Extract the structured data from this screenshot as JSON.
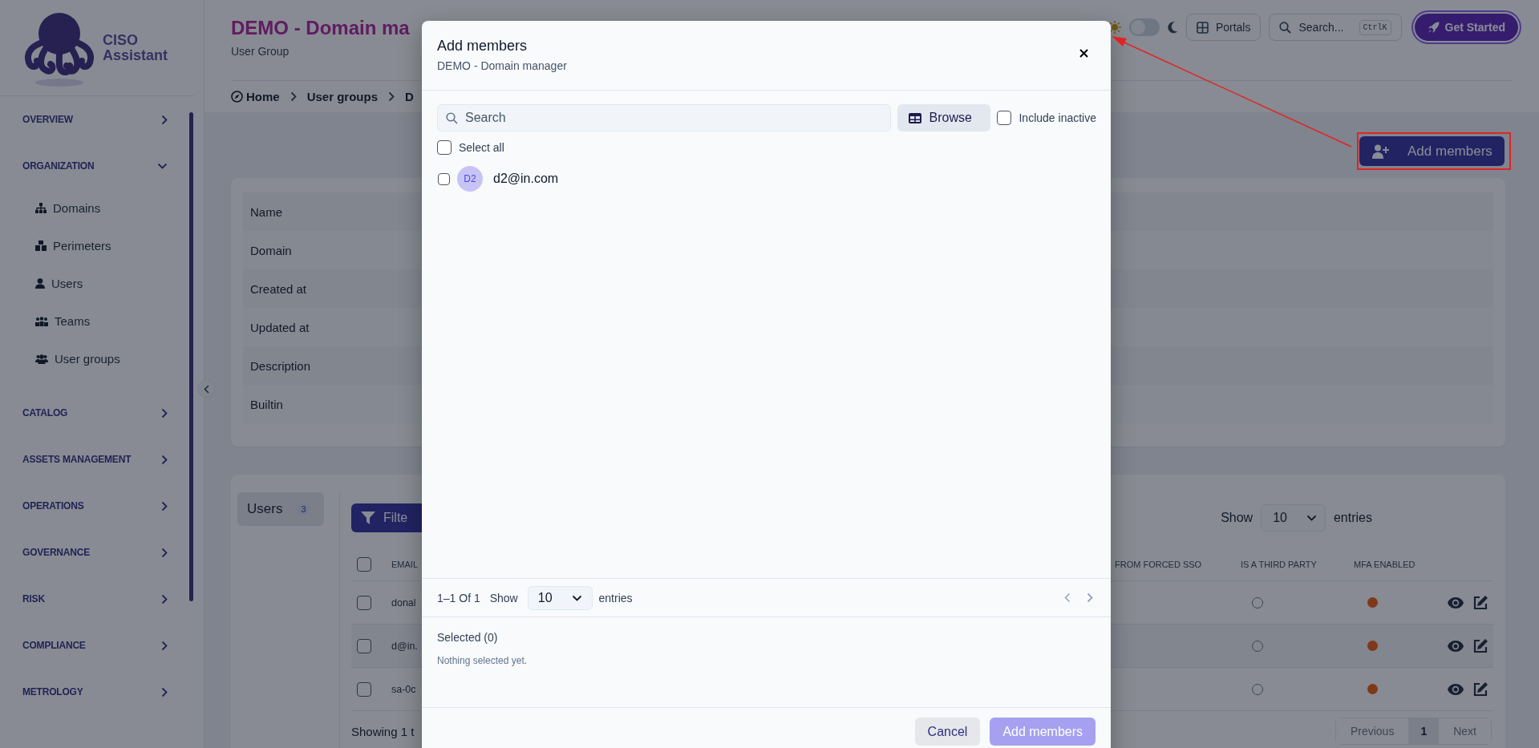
{
  "sidebar": {
    "logo_text": "CISO Assistant",
    "groups": [
      {
        "label": "OVERVIEW",
        "expanded": false
      },
      {
        "label": "ORGANIZATION",
        "expanded": true,
        "items": [
          {
            "label": "Domains"
          },
          {
            "label": "Perimeters"
          },
          {
            "label": "Users"
          },
          {
            "label": "Teams"
          },
          {
            "label": "User groups"
          }
        ]
      },
      {
        "label": "CATALOG",
        "expanded": false
      },
      {
        "label": "ASSETS MANAGEMENT",
        "expanded": false
      },
      {
        "label": "OPERATIONS",
        "expanded": false
      },
      {
        "label": "GOVERNANCE",
        "expanded": false
      },
      {
        "label": "RISK",
        "expanded": false
      },
      {
        "label": "COMPLIANCE",
        "expanded": false
      },
      {
        "label": "METROLOGY",
        "expanded": false
      }
    ]
  },
  "header": {
    "title": "DEMO - Domain ma",
    "subtitle": "User Group",
    "breadcrumbs": [
      "Home",
      "User groups",
      "D"
    ],
    "dark_mode": false,
    "portals": "Portals",
    "search_label": "Search...",
    "search_shortcut": "CtrlK",
    "get_started": "Get Started"
  },
  "add_members_button": "Add members",
  "details": {
    "fields": [
      "Name",
      "Domain",
      "Created at",
      "Updated at",
      "Description",
      "Builtin"
    ]
  },
  "users_panel": {
    "tabs": [
      {
        "label": "Users",
        "count": "3",
        "selected": true
      }
    ],
    "filter_button": "Filte",
    "page_size_label": "Show",
    "page_size": "10",
    "entries_label": "entries",
    "select_all": {
      "checked": false
    },
    "columns": [
      "EMAIL",
      "FROM FORCED SSO",
      "IS A THIRD PARTY",
      "MFA ENABLED"
    ],
    "rows": [
      {
        "email": "donal",
        "checked": false,
        "third_party": false,
        "mfa_enabled": false
      },
      {
        "email": "d@in.",
        "checked": false,
        "third_party": false,
        "mfa_enabled": false
      },
      {
        "email": "sa-0c",
        "checked": false,
        "third_party": false,
        "mfa_enabled": false
      }
    ],
    "showing": "Showing 1 t",
    "pagination": {
      "previous": "Previous",
      "pages": [
        {
          "label": "1",
          "selected": true
        }
      ],
      "next": "Next"
    }
  },
  "modal": {
    "title": "Add members",
    "subtitle": "DEMO - Domain manager",
    "search_placeholder": "Search",
    "browse": "Browse",
    "include_inactive": {
      "label": "Include inactive",
      "checked": false
    },
    "select_all": {
      "label": "Select all",
      "checked": false
    },
    "candidates": [
      {
        "initials": "D2",
        "email": "d2@in.com",
        "checked": false
      }
    ],
    "range": "1–1 Of 1",
    "page_size_label": "Show",
    "page_size": "10",
    "entries_label": "entries",
    "selected_title": "Selected (0)",
    "empty_text": "Nothing selected yet.",
    "cancel": "Cancel",
    "submit": {
      "label": "Add members",
      "disabled": true
    }
  }
}
